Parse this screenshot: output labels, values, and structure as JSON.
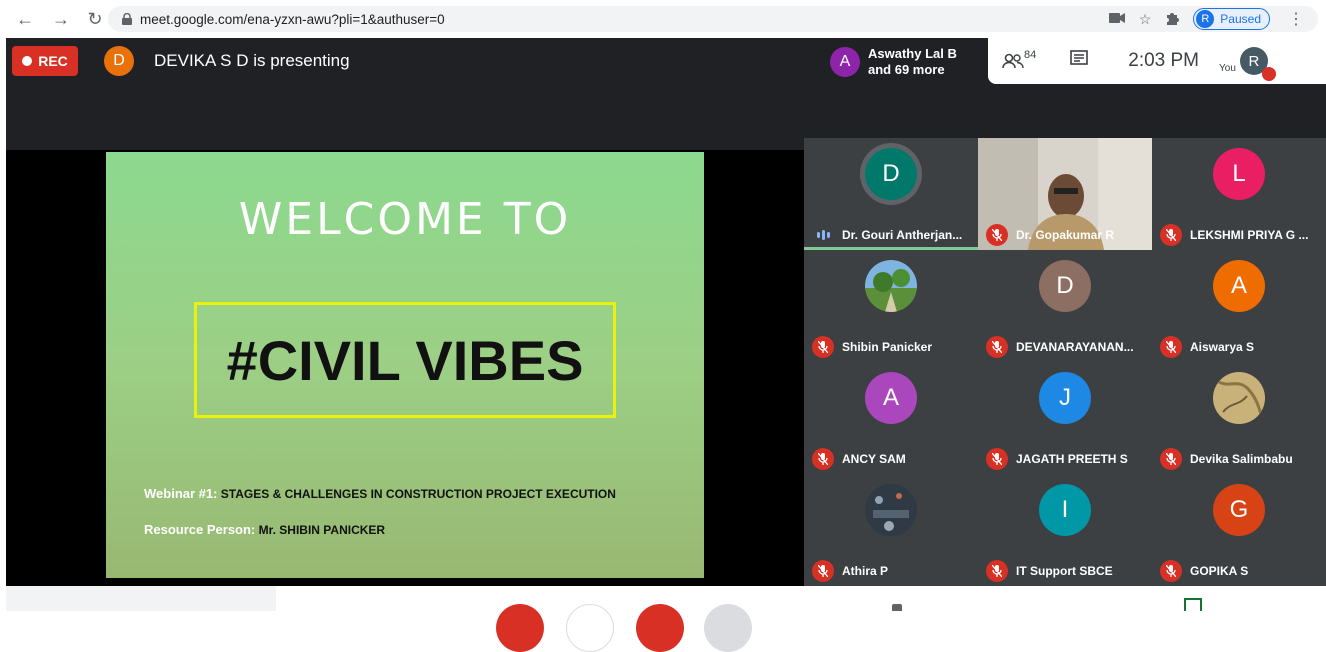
{
  "browser": {
    "url": "meet.google.com/ena-yzxn-awu?pli=1&authuser=0",
    "profile_initial": "R",
    "profile_status": "Paused"
  },
  "meet": {
    "rec_label": "REC",
    "presenter_initial": "D",
    "presenting_text": "DEVIKA S D is presenting",
    "speaker": {
      "initial": "A",
      "line1": "Aswathy Lal B",
      "line2": "and 69 more"
    },
    "participant_count": "84",
    "time": "2:03 PM",
    "you_label": "You",
    "you_initial": "R"
  },
  "slide": {
    "welcome": "WELCOME TO",
    "title": "#CIVIL VIBES",
    "line1_key": "Webinar #1:",
    "line1_value": "STAGES & CHALLENGES IN CONSTRUCTION PROJECT EXECUTION",
    "line2_key": "Resource Person:",
    "line2_value": "Mr. SHIBIN PANICKER"
  },
  "tiles": [
    {
      "name": "Dr. Gouri Antherjan...",
      "initial": "D",
      "color": "#00796b",
      "state": "speaking"
    },
    {
      "name": "Dr. Gopakumar R",
      "initial": "",
      "color": "",
      "state": "muted"
    },
    {
      "name": "LEKSHMI PRIYA G ...",
      "initial": "L",
      "color": "#e91e63",
      "state": "muted"
    },
    {
      "name": "Shibin Panicker",
      "initial": "",
      "color": "",
      "state": "muted"
    },
    {
      "name": "DEVANARAYANAN...",
      "initial": "D",
      "color": "#8d6e63",
      "state": "muted"
    },
    {
      "name": "Aiswarya S",
      "initial": "A",
      "color": "#ef6c00",
      "state": "muted"
    },
    {
      "name": "ANCY SAM",
      "initial": "A",
      "color": "#ab47bc",
      "state": "muted"
    },
    {
      "name": "JAGATH PREETH S",
      "initial": "J",
      "color": "#1e88e5",
      "state": "muted"
    },
    {
      "name": "Devika Salimbabu",
      "initial": "",
      "color": "",
      "state": "muted"
    },
    {
      "name": "Athira P",
      "initial": "",
      "color": "",
      "state": "muted"
    },
    {
      "name": "IT Support SBCE",
      "initial": "I",
      "color": "#0097a7",
      "state": "muted"
    },
    {
      "name": "GOPIKA S",
      "initial": "G",
      "color": "#d84315",
      "state": "muted"
    }
  ]
}
